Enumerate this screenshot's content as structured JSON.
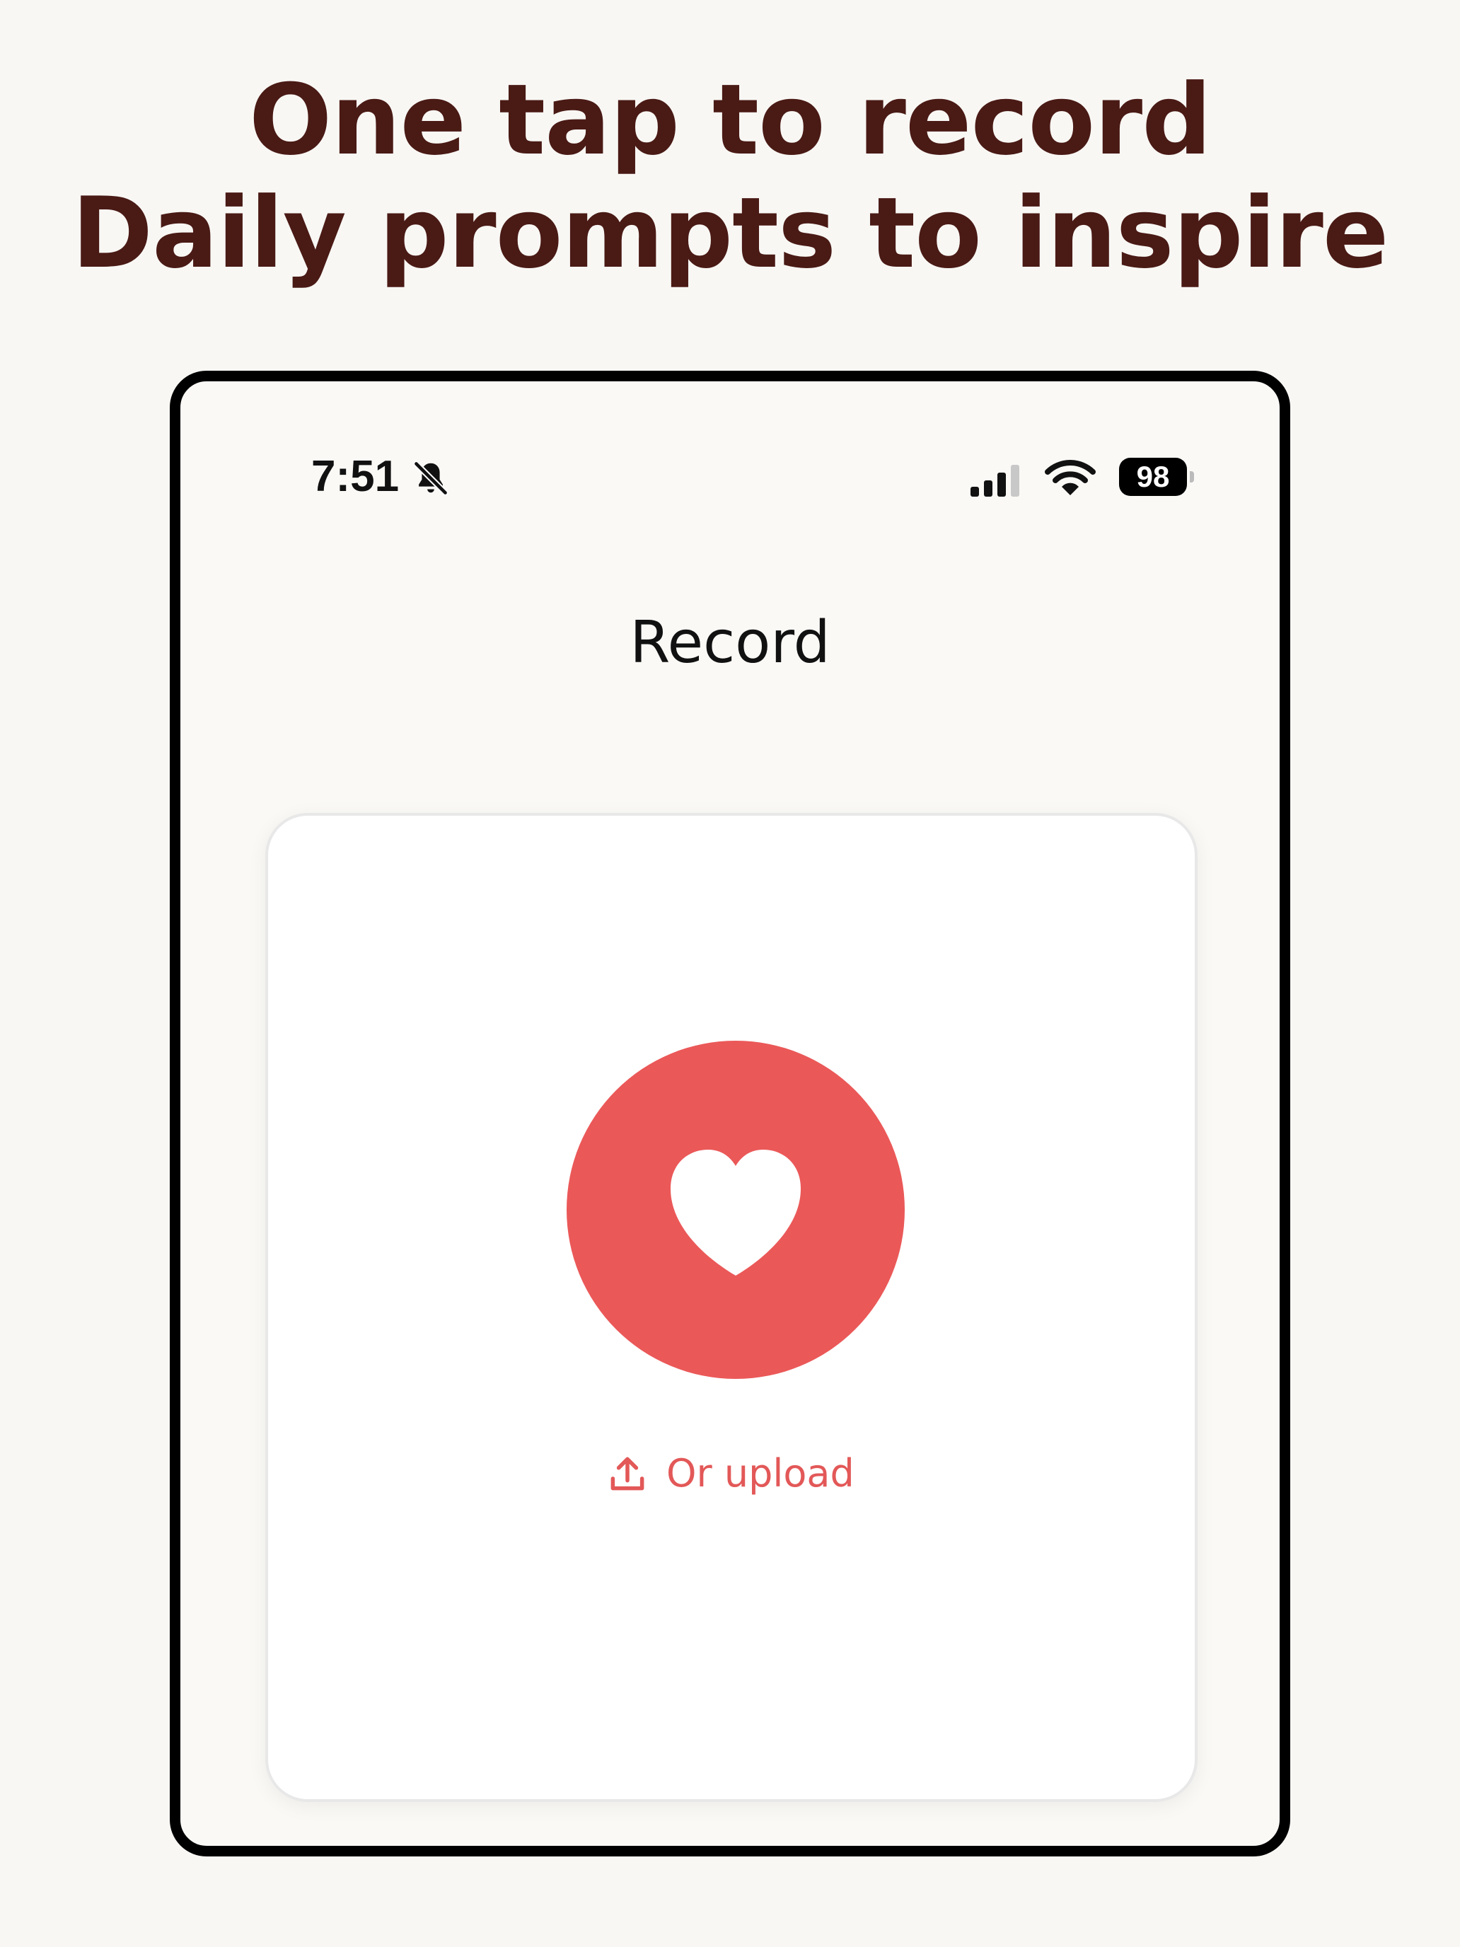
{
  "headline": {
    "line1": "One tap to record",
    "line2": "Daily prompts to inspire"
  },
  "status_bar": {
    "time": "7:51",
    "silent_icon": "bell-slash-icon",
    "signal_icon": "cellular-signal-icon",
    "wifi_icon": "wifi-icon",
    "battery_level": "98"
  },
  "screen": {
    "title": "Record"
  },
  "record": {
    "button_icon": "heart-icon",
    "upload_icon": "upload-icon",
    "upload_label": "Or upload"
  },
  "colors": {
    "accent": "#eb5858",
    "headline": "#4a1a15",
    "background": "#f8f7f4"
  }
}
